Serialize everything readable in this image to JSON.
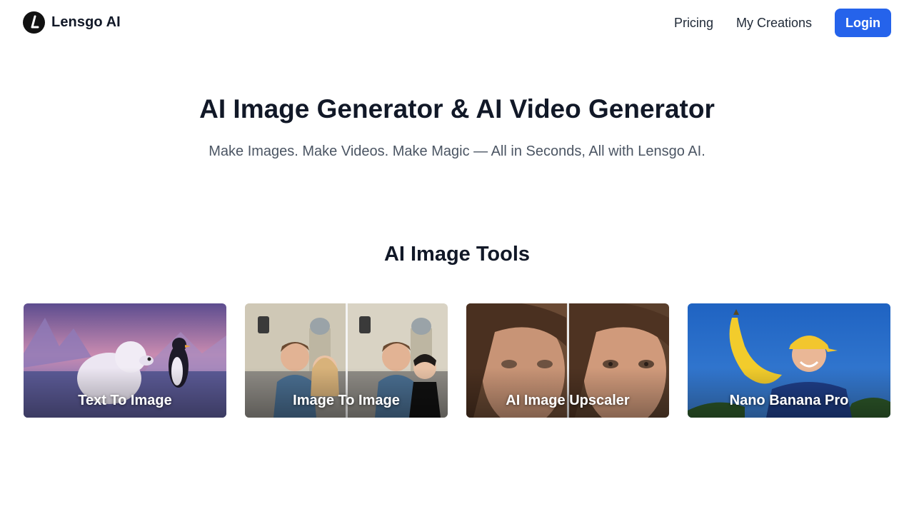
{
  "header": {
    "brand": "Lensgo AI",
    "nav": [
      {
        "label": "Pricing"
      },
      {
        "label": "My Creations"
      }
    ],
    "login_label": "Login",
    "login_color": "#2563eb"
  },
  "hero": {
    "title": "AI Image Generator & AI Video Generator",
    "subtitle": "Make Images. Make Videos. Make Magic — All in Seconds, All with Lensgo AI."
  },
  "tools_section": {
    "title": "AI Image Tools",
    "cards": [
      {
        "label": "Text To Image",
        "image": "polar-bear-and-penguin-illustration"
      },
      {
        "label": "Image To Image",
        "image": "couple-selfie-before-after"
      },
      {
        "label": "AI Image Upscaler",
        "image": "portrait-blurry-vs-sharp"
      },
      {
        "label": "Nano Banana Pro",
        "image": "man-holding-banana"
      }
    ]
  }
}
